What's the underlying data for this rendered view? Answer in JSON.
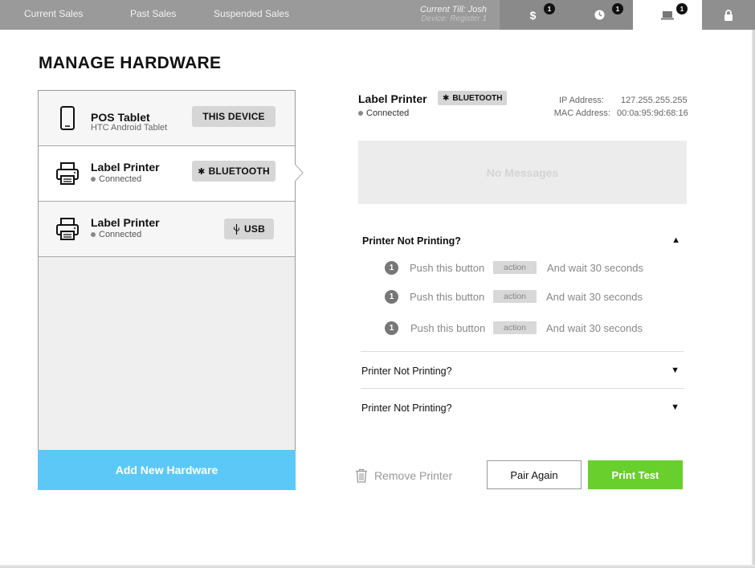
{
  "topbar": {
    "nav": [
      "Current Sales",
      "Past Sales",
      "Suspended Sales"
    ],
    "till_line1": "Current Till: Josh",
    "till_line2": "Device: Register 1",
    "buttons": [
      {
        "icon": "dollar-icon",
        "glyph": "$",
        "badge": "1"
      },
      {
        "icon": "clock-icon",
        "glyph": "◷",
        "badge": "1"
      },
      {
        "icon": "laptop-icon",
        "glyph": "▬",
        "badge": "1"
      },
      {
        "icon": "lock-icon",
        "glyph": "",
        "badge": ""
      }
    ]
  },
  "page": {
    "title": "MANAGE HARDWARE"
  },
  "devices": [
    {
      "name": "POS Tablet",
      "sub": "HTC Android Tablet",
      "tag": "THIS DEVICE",
      "icon": "tablet-icon"
    },
    {
      "name": "Label Printer",
      "sub": "Connected",
      "tag": "BLUETOOTH",
      "icon": "printer-icon"
    },
    {
      "name": "Label Printer",
      "sub": "Connected",
      "tag": "USB",
      "icon": "printer-icon"
    }
  ],
  "add_hardware_label": "Add New Hardware",
  "detail": {
    "name": "Label Printer",
    "tag": "BLUETOOTH",
    "status": "Connected",
    "ip_label": "IP Address:",
    "ip_value": "127.255.255.255",
    "mac_label": "MAC Address:",
    "mac_value": "00:0a:95:9d:68:16",
    "messages": "No Messages"
  },
  "troubleshooting": {
    "sections": [
      "Printer Not Printing?",
      "Printer Not Printing?",
      "Printer Not Printing?"
    ],
    "steps": [
      {
        "num": "1",
        "text": "Push this button",
        "action": "action",
        "after": "And wait 30 seconds"
      },
      {
        "num": "1",
        "text": "Push this button",
        "action": "action",
        "after": "And wait 30 seconds"
      },
      {
        "num": "1",
        "text": "Push this button",
        "action": "action",
        "after": "And wait 30 seconds"
      }
    ]
  },
  "actions": {
    "remove": "Remove Printer",
    "pair": "Pair Again",
    "print": "Print Test"
  },
  "colors": {
    "topbar": "#9a9a9a",
    "add_button": "#5cc8f7",
    "print_button": "#69cf2c"
  }
}
